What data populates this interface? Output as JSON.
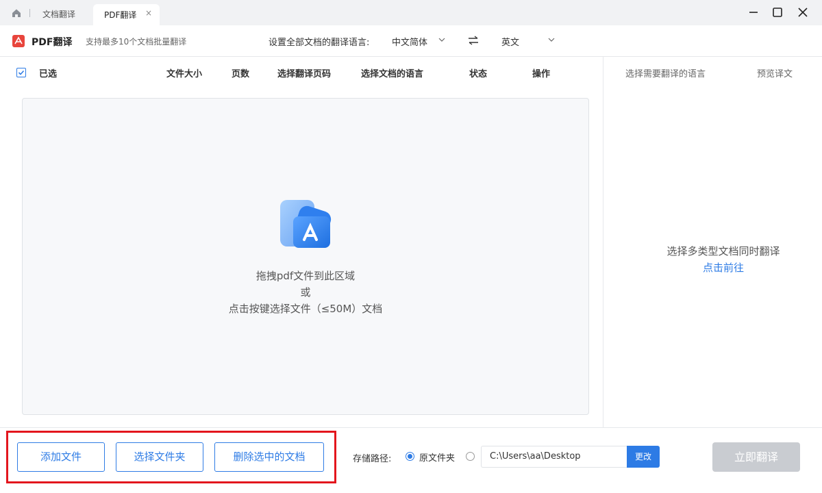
{
  "titlebar": {
    "tabs": [
      {
        "label": "文档翻译"
      },
      {
        "label": "PDF翻译",
        "close": "×"
      }
    ]
  },
  "toolbar": {
    "title": "PDF翻译",
    "subtitle": "支持最多10个文档批量翻译",
    "lang_label": "设置全部文档的翻译语言:",
    "source_lang": "中文简体",
    "target_lang": "英文"
  },
  "table": {
    "headers": [
      "已选",
      "文件大小",
      "页数",
      "选择翻译页码",
      "选择文档的语言",
      "状态",
      "操作"
    ],
    "select_all_checked": true
  },
  "dropzone": {
    "line1": "拖拽pdf文件到此区域",
    "line2": "或",
    "line3": "点击按键选择文件（≤50M）文档"
  },
  "right_panel": {
    "col1": "选择需要翻译的语言",
    "col2": "预览译文",
    "message": "选择多类型文档同时翻译",
    "link": "点击前往"
  },
  "bottom": {
    "buttons": [
      "添加文件",
      "选择文件夹",
      "删除选中的文档"
    ],
    "storage_label": "存储路径:",
    "option_original": "原文件夹",
    "path": "C:\\Users\\aa\\Desktop",
    "change_label": "更改",
    "translate_label": "立即翻译"
  },
  "colors": {
    "accent": "#2d7be5",
    "highlight": "#e3161d",
    "disabled": "#c9ccd1"
  }
}
